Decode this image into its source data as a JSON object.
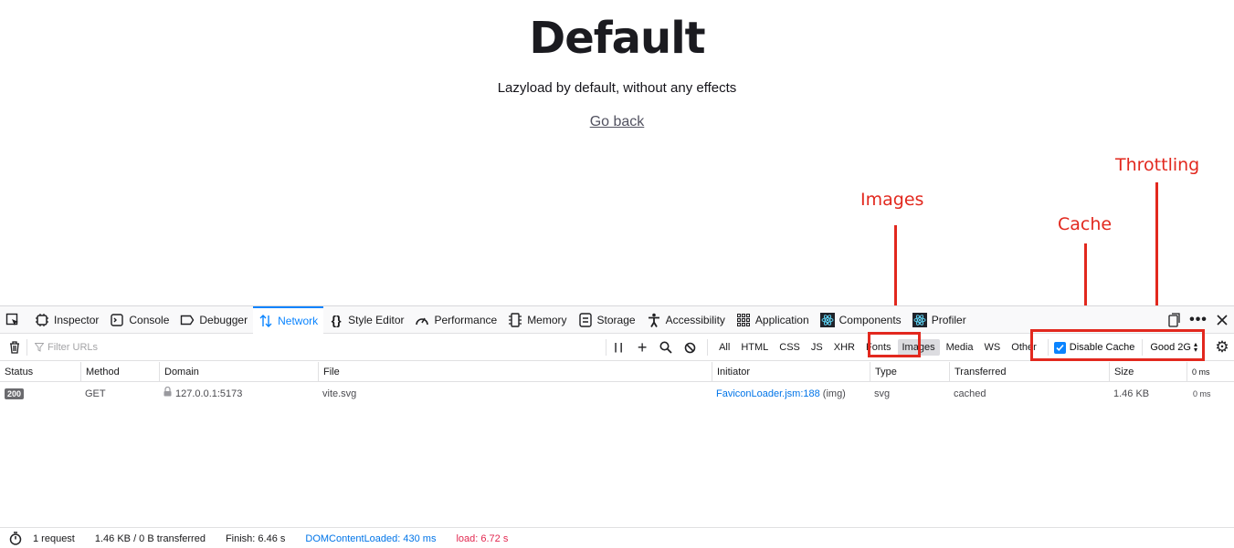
{
  "page": {
    "title": "Default",
    "subtitle": "Lazyload by default, without any effects",
    "link": "Go back"
  },
  "annotations": {
    "images": "Images",
    "cache": "Cache",
    "throttling": "Throttling",
    "color": "#e2281e"
  },
  "devtools": {
    "tabs": [
      "Inspector",
      "Console",
      "Debugger",
      "Network",
      "Style Editor",
      "Performance",
      "Memory",
      "Storage",
      "Accessibility",
      "Application",
      "Components",
      "Profiler"
    ],
    "active_tab": "Network",
    "filter_placeholder": "Filter URLs",
    "type_filters": [
      "All",
      "HTML",
      "CSS",
      "JS",
      "XHR",
      "Fonts",
      "Images",
      "Media",
      "WS",
      "Other"
    ],
    "active_type": "Images",
    "disable_cache_label": "Disable Cache",
    "disable_cache_checked": true,
    "throttling": "Good 2G",
    "columns": [
      "Status",
      "Method",
      "Domain",
      "File",
      "Initiator",
      "Type",
      "Transferred",
      "Size",
      "0 ms"
    ],
    "rows": [
      {
        "status": "200",
        "method": "GET",
        "domain": "127.0.0.1:5173",
        "file": "vite.svg",
        "initiator": "FaviconLoader.jsm:188",
        "initiator_suffix": "(img)",
        "type": "svg",
        "transferred": "cached",
        "size": "1.46 KB",
        "timing": "0 ms"
      }
    ],
    "status_bar": {
      "requests": "1 request",
      "transferred": "1.46 KB / 0 B transferred",
      "finish": "Finish: 6.46 s",
      "dom_loaded": "DOMContentLoaded: 430 ms",
      "load": "load: 6.72 s"
    },
    "accent": "#0a84ff"
  }
}
